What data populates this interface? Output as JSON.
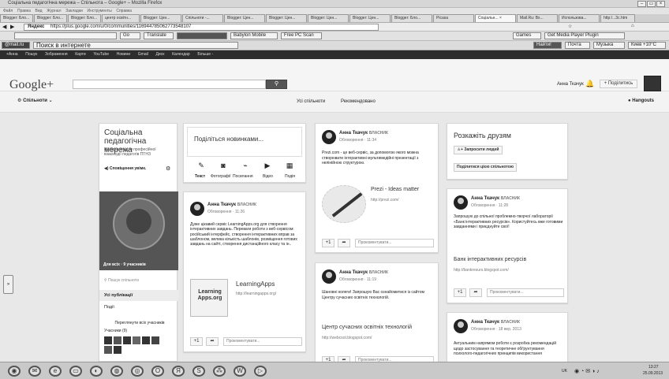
{
  "window": {
    "title": "Соціальна педагогічна мережа – Спільнота – Google+ – Mozilla Firefox",
    "menu": [
      "Файл",
      "Правка",
      "Вид",
      "Журнал",
      "Закладки",
      "Инструменты",
      "Справка"
    ]
  },
  "tabs": [
    {
      "label": "Blogger: Бло..."
    },
    {
      "label": "Blogger: Бло..."
    },
    {
      "label": "Blogger: Бло..."
    },
    {
      "label": "центр освітн..."
    },
    {
      "label": "Blogger: Цен..."
    },
    {
      "label": "Спільноти -..."
    },
    {
      "label": "Blogger: Цен..."
    },
    {
      "label": "Blogger: Цен..."
    },
    {
      "label": "Blogger: Цен..."
    },
    {
      "label": "Blogger: Цен..."
    },
    {
      "label": "Blogger: Бло..."
    },
    {
      "label": "Picasa"
    },
    {
      "label": "Соціальн... ×",
      "active": true
    },
    {
      "label": "Mail.Ru: Вх..."
    },
    {
      "label": "Использова..."
    },
    {
      "label": "http:/...3c.htm"
    }
  ],
  "navbar": {
    "url_prefix": "Яндекс",
    "url": "https://plus.google.com/u/0/communities/116944785062773548107"
  },
  "toolbar1": {
    "goto": "Go",
    "translate": "Translate",
    "babylon": "Babylon Mobile",
    "free_pc_scan": "Free PC Scan",
    "games": "Games",
    "media_player": "Get Media Player Plugin"
  },
  "toolbar2": {
    "mail": "@mail.ru",
    "search_placeholder": "Поиск в интернете",
    "find": "Найти!",
    "mail_link": "Почта",
    "music": "Музыка",
    "kyiv": "Киев +10°C"
  },
  "gbar": [
    "+Анна",
    "Пошук",
    "Зображення",
    "Карти",
    "YouTube",
    "Новини",
    "Gmail",
    "Диск",
    "Календар",
    "Більше -"
  ],
  "gheader": {
    "logo": "Google+",
    "user_name": "Анна Ткачук",
    "share": "+  Поділитись"
  },
  "subheader": {
    "communities": "Спільноти",
    "tab_all": "Усі спільноти",
    "tab_recommended": "Рекомендовано",
    "hangouts": "Hangouts"
  },
  "community": {
    "title": "Соціальна педагогічна мережа",
    "desc": "Майданчик для професійної взаємодії педагогів ПТНЗ",
    "notifications": "Сповіщення увімк.",
    "photo_caption": "Для всіх · 9 учасників",
    "search_placeholder": "Пошук спільноти",
    "nav_all": "Усі публікації",
    "nav_events": "Події",
    "members_link": "Переглянути всіх учасників",
    "members_count": "Учасники (9)"
  },
  "share_box": {
    "prompt": "Поділіться новинками...",
    "actions": [
      "Текст",
      "Фотографії",
      "Посилання",
      "Відео",
      "Подія"
    ]
  },
  "posts": [
    {
      "author": "Анна Ткачук",
      "role": "ВЛАСНИК",
      "meta": "Обговорення · 11:26",
      "text": "Дуже цікавий сервіс LearningApps.org  для створення інтерактивних завдань.  Переваги роботи з веб-сервісом: російський інтерфейс, створення інтерактивних вправ за шаблоном, велика кількість шаблонів, розміщення готових завдань на сайті, створення дистанційного класу та ін..",
      "link_title": "LearningApps",
      "link_url": "http://learningapps.org/",
      "thumb_text": "Learning Apps.org",
      "plus": "+1",
      "comment": "Прокоментувати..."
    },
    {
      "author": "Анна Ткачук",
      "role": "ВЛАСНИК",
      "meta": "Обговорення · 11:34",
      "text": "Prezi.com - це веб-сервіс, за допомогою якого можна створювати інтерактивні мультимедійні презентації з нелінійною структурою.",
      "link_title": "Prezi - Ideas matter",
      "link_url": "http://prezi.com/",
      "plus": "+1",
      "comment": "Прокоментувати..."
    },
    {
      "author": "Анна Ткачук",
      "role": "ВЛАСНИК",
      "meta": "Обговорення · 11:19",
      "text": "Шановні колеги! Запрошую Вас ознайомитися із сайтом Центру сучасних освітніх технологій.",
      "link_title": "Центр сучасних освітніх технологій",
      "link_url": "http://webcsot.blogspot.com/",
      "plus": "+1",
      "comment": "Прокоментувати..."
    },
    {
      "author": "Анна Ткачук",
      "role": "ВЛАСНИК",
      "meta": "Обговорення · 11:28",
      "text": "Запрошую до спільної проблемно-творчої лабораторії «Банк інтерактивних ресурсів». Користуйтесь вже готовими завданнями і приєднуйте свої!",
      "link_title": "Банк інтерактивних ресурсів",
      "link_url": "http://bankresurs.blogspot.com/",
      "plus": "+1",
      "comment": "Прокоментувати..."
    },
    {
      "author": "Анна Ткачук",
      "role": "ВЛАСНИК",
      "meta": "Обговорення · 18 вер. 2013",
      "text": "Актуальним напрямом роботи є розробка рекомендацій щодо застосування та теоретичне обґрунтування психолого-педагогічних принципів використання"
    }
  ],
  "tell_friends": {
    "title": "Розкажіть друзям",
    "invite": "Запросити людей",
    "share": "Поділитися цією спільнотою"
  },
  "taskbar": {
    "lang": "UK",
    "time": "13:27",
    "date": "25.09.2013"
  }
}
